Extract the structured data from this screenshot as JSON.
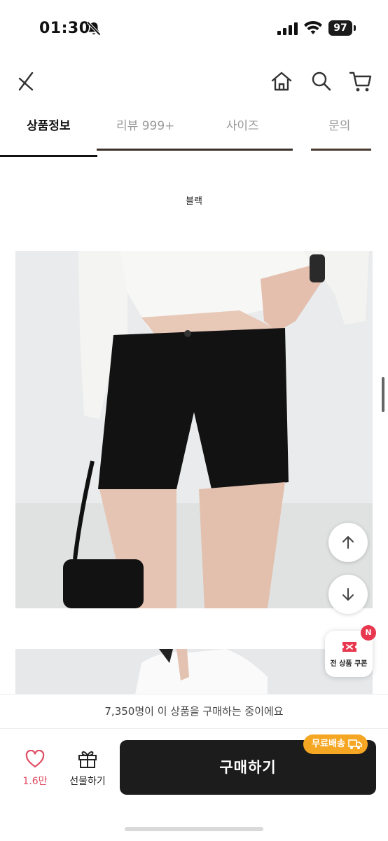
{
  "status_bar": {
    "time": "01:30",
    "battery": "97"
  },
  "header": {
    "back_icon": "chevron-left-icon",
    "home_icon": "home-icon",
    "search_icon": "search-icon",
    "cart_icon": "cart-icon"
  },
  "tabs": [
    {
      "label": "상품정보",
      "active": true
    },
    {
      "label": "리뷰 999+",
      "active": false
    },
    {
      "label": "사이즈",
      "active": false
    },
    {
      "label": "문의",
      "active": false
    }
  ],
  "content": {
    "color_label": "블랙"
  },
  "coupon": {
    "label": "전 상품 쿠폰",
    "badge": "N",
    "accent": "#e8374f"
  },
  "notice": {
    "text": "7,350명이 이 상품을 구매하는 중이에요"
  },
  "bottom_bar": {
    "like_count": "1.6만",
    "gift_label": "선물하기",
    "buy_label": "구매하기",
    "free_shipping_label": "무료배송",
    "accent_free_shipping": "#f5a623",
    "buy_button_color": "#1c1c1c"
  }
}
